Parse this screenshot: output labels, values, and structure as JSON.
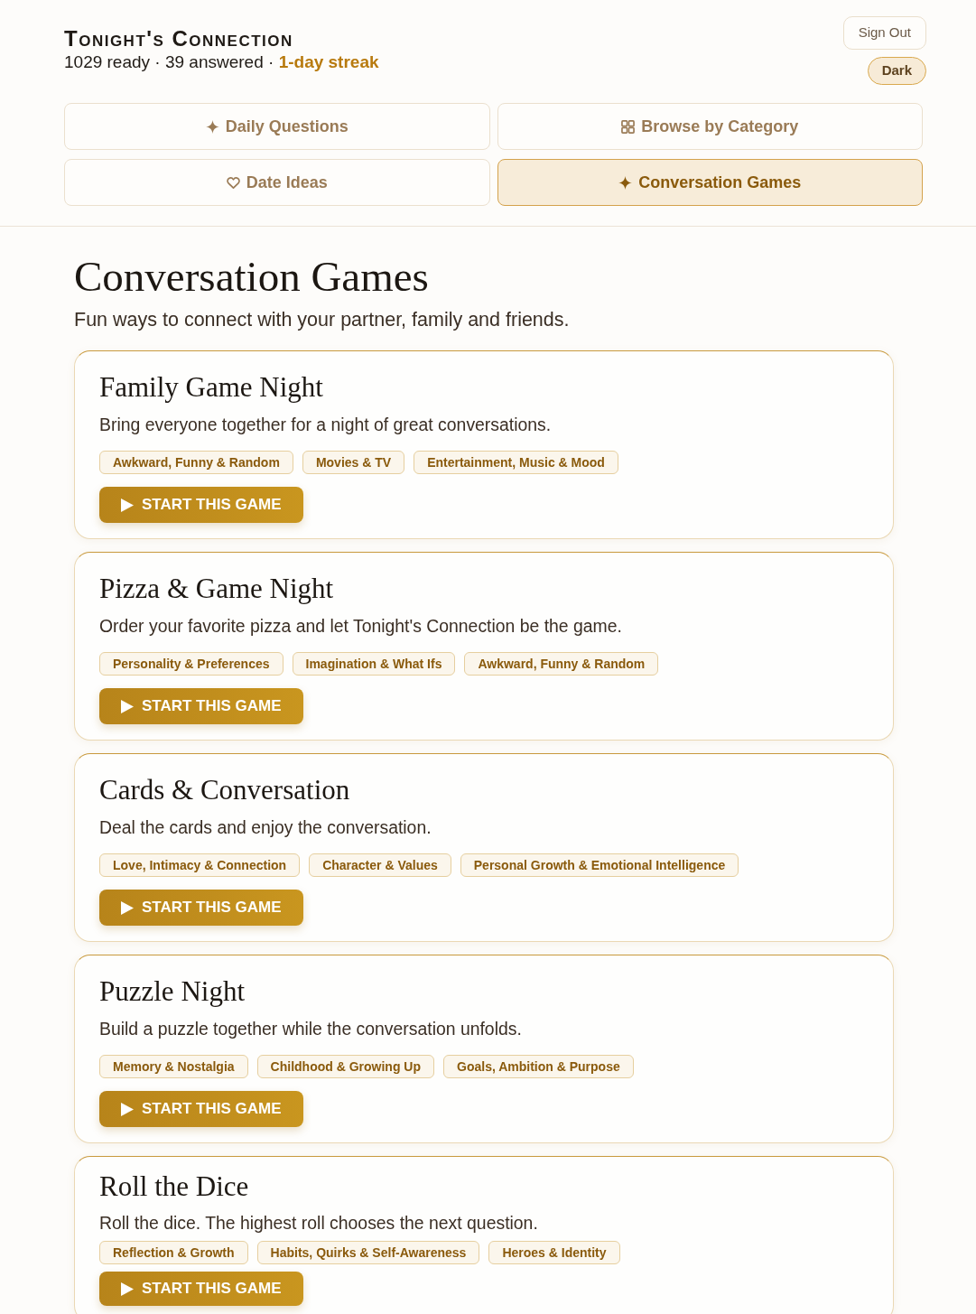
{
  "header": {
    "title": "Tonight's Connection",
    "stats": "1029 ready · 39 answered · **1-day streak**",
    "sign_out": "Sign Out",
    "theme_toggle": "Dark"
  },
  "tabs": [
    {
      "label": "Daily Questions",
      "selected": false
    },
    {
      "label": "Browse by Category",
      "selected": false
    },
    {
      "label": "Date Ideas",
      "selected": false
    },
    {
      "label": "Conversation Games",
      "selected": true
    }
  ],
  "page": {
    "heading": "Conversation Games",
    "subtitle": "Fun ways to connect with your partner, family and friends."
  },
  "games": [
    {
      "title": "Family Game Night",
      "description": "Bring everyone together for a night of great conversations.",
      "tags": [
        "Awkward, Funny & Random",
        "Movies & TV",
        "Entertainment, Music & Mood"
      ],
      "button": "START THIS GAME"
    },
    {
      "title": "Pizza & Game Night",
      "description": "Order your favorite pizza and let Tonight's Connection be the game.",
      "tags": [
        "Personality & Preferences",
        "Imagination & What Ifs",
        "Awkward, Funny & Random"
      ],
      "button": "START THIS GAME"
    },
    {
      "title": "Cards & Conversation",
      "description": "Deal the cards and enjoy the conversation.",
      "tags": [
        "Love, Intimacy & Connection",
        "Character & Values",
        "Personal Growth & Emotional Intelligence"
      ],
      "button": "START THIS GAME"
    },
    {
      "title": "Puzzle Night",
      "description": "Build a puzzle together while the conversation unfolds.",
      "tags": [
        "Memory & Nostalgia",
        "Childhood & Growing Up",
        "Goals, Ambition & Purpose"
      ],
      "button": "START THIS GAME"
    },
    {
      "title": "Roll the Dice",
      "description": "Roll the dice. The highest roll chooses the next question.",
      "tags": [
        "Reflection & Growth",
        "Habits, Quirks & Self-Awareness",
        "Heroes & Identity"
      ],
      "button": "START THIS GAME"
    }
  ]
}
